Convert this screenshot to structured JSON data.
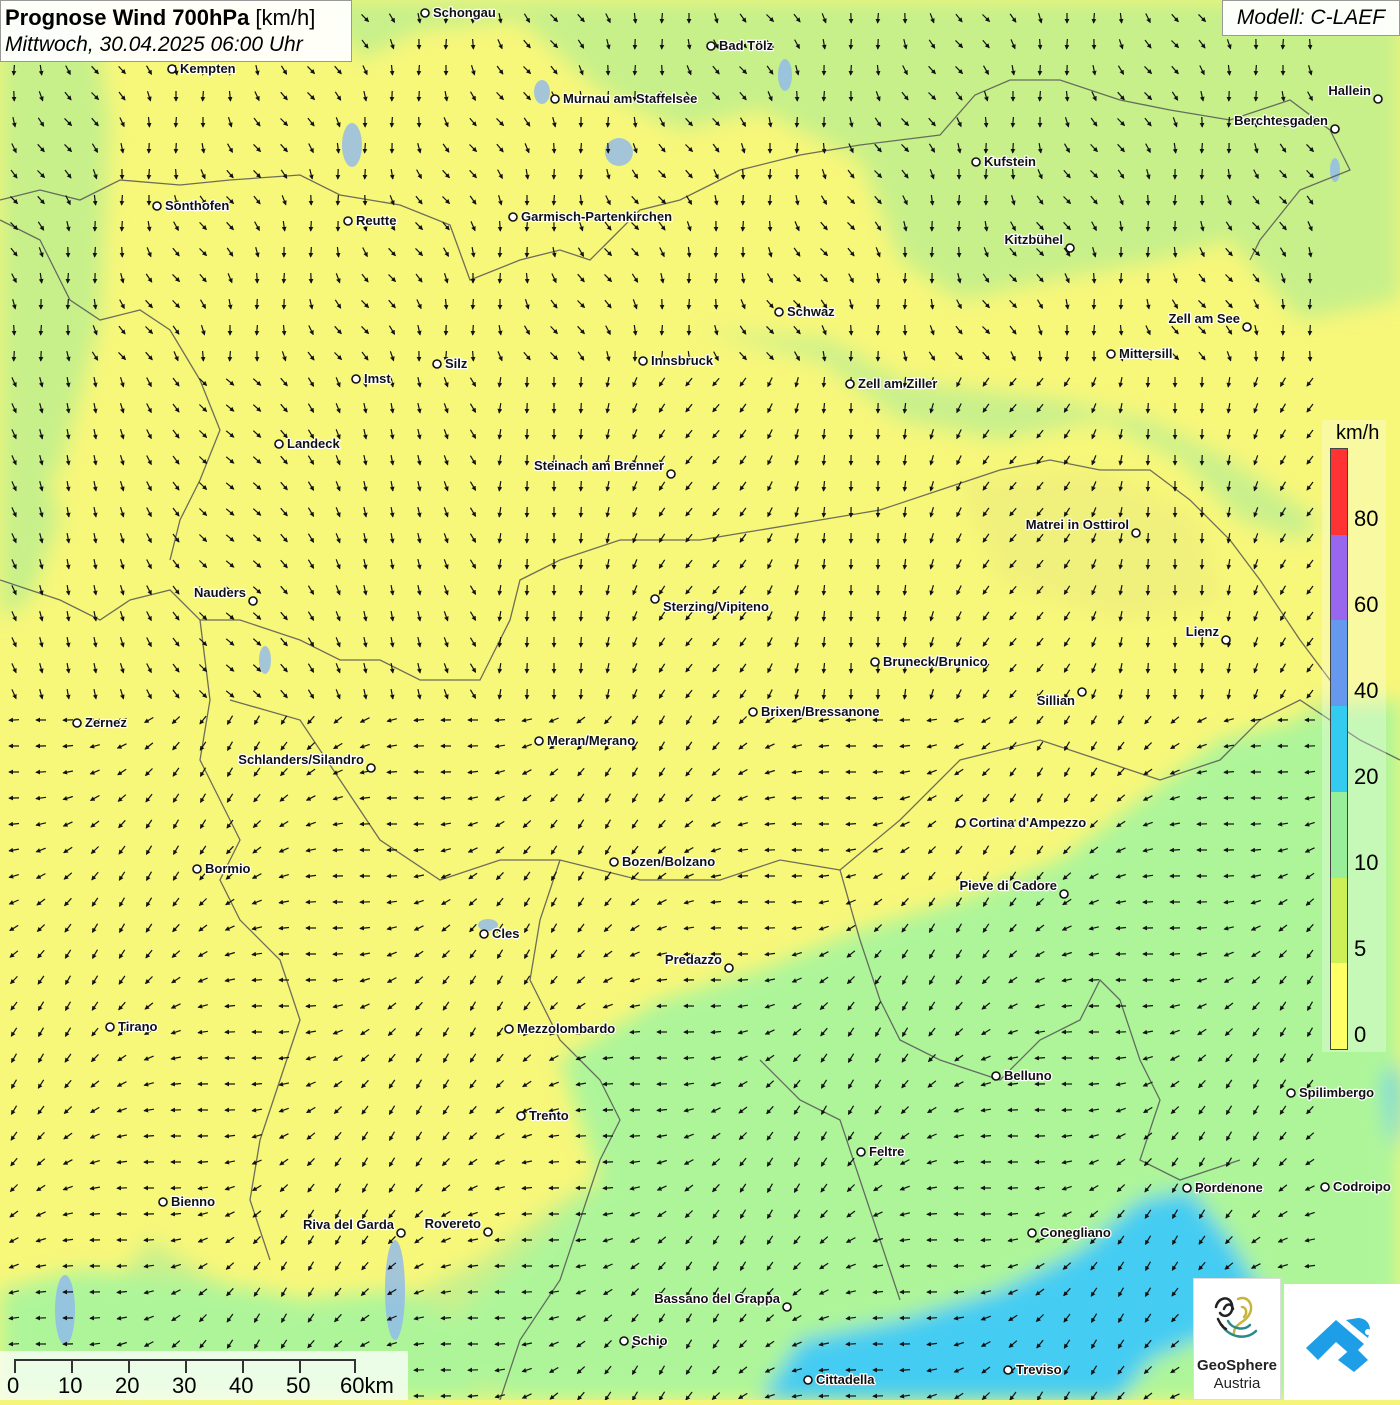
{
  "title": {
    "bold": "Prognose Wind 700hPa",
    "unit": " [km/h]",
    "date": "Mittwoch, 30.04.2025 06:00 Uhr"
  },
  "model": "Modell: C-LAEF",
  "legend": {
    "unit": "km/h",
    "ticks": [
      "80",
      "60",
      "40",
      "20",
      "10",
      "5",
      "0"
    ],
    "colors": [
      "#ff3333",
      "#9966ee",
      "#6699ee",
      "#33ccf0",
      "#99ee99",
      "#ccf055",
      "#ffff66"
    ]
  },
  "scale": {
    "labels": [
      "0",
      "10",
      "20",
      "30",
      "40",
      "50",
      "60km"
    ]
  },
  "logos": {
    "geosphere_line1": "GeoSphere",
    "geosphere_line2": "Austria"
  },
  "colors": {
    "yellow": "#f7f77a",
    "yellow_green": "#d8f07a",
    "light_green": "#aef59a",
    "cyan": "#44ccf2",
    "border": "#555555"
  },
  "cities": [
    {
      "name": "Schongau"
    },
    {
      "name": "Bad Tölz"
    },
    {
      "name": "Kempten"
    },
    {
      "name": "Murnau am Staffelsee"
    },
    {
      "name": "Hallein"
    },
    {
      "name": "Berchtesgaden"
    },
    {
      "name": "Kufstein"
    },
    {
      "name": "Sonthofen"
    },
    {
      "name": "Reutte"
    },
    {
      "name": "Garmisch-Partenkirchen"
    },
    {
      "name": "Kitzbühel"
    },
    {
      "name": "Schwaz"
    },
    {
      "name": "Zell am See"
    },
    {
      "name": "Mittersill"
    },
    {
      "name": "Silz"
    },
    {
      "name": "Innsbruck"
    },
    {
      "name": "Imst"
    },
    {
      "name": "Zell am Ziller"
    },
    {
      "name": "Landeck"
    },
    {
      "name": "Steinach am Brenner"
    },
    {
      "name": "Matrei in Osttirol"
    },
    {
      "name": "Nauders"
    },
    {
      "name": "Sterzing/Vipiteno"
    },
    {
      "name": "Lienz"
    },
    {
      "name": "Bruneck/Brunico"
    },
    {
      "name": "Sillian"
    },
    {
      "name": "Zernez"
    },
    {
      "name": "Brixen/Bressanone"
    },
    {
      "name": "Meran/Merano"
    },
    {
      "name": "Schlanders/Silandro"
    },
    {
      "name": "Cortina d'Ampezzo"
    },
    {
      "name": "Bormio"
    },
    {
      "name": "Bozen/Bolzano"
    },
    {
      "name": "Pieve di Cadore"
    },
    {
      "name": "Cles"
    },
    {
      "name": "Predazzo"
    },
    {
      "name": "Tirano"
    },
    {
      "name": "Mezzolombardo"
    },
    {
      "name": "Belluno"
    },
    {
      "name": "Spilimbergo"
    },
    {
      "name": "Trento"
    },
    {
      "name": "Feltre"
    },
    {
      "name": "Pordenone"
    },
    {
      "name": "Codroipo"
    },
    {
      "name": "Bienno"
    },
    {
      "name": "Riva del Garda"
    },
    {
      "name": "Rovereto"
    },
    {
      "name": "Conegliano"
    },
    {
      "name": "Bassano del Grappa"
    },
    {
      "name": "Schio"
    },
    {
      "name": "Treviso"
    },
    {
      "name": "Cittadella"
    }
  ]
}
